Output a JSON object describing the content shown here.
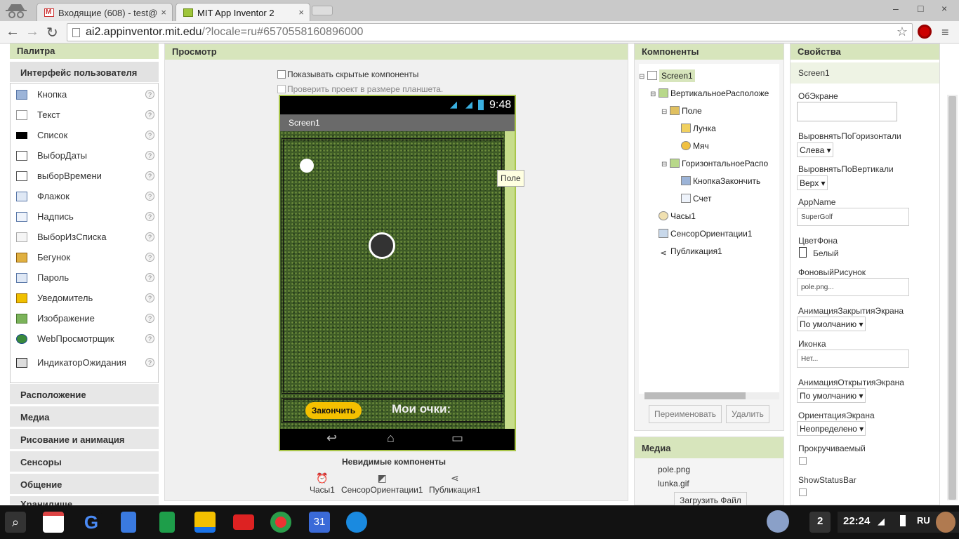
{
  "browser": {
    "tabs": [
      {
        "title": "Входящие (608) - test@",
        "close": "×"
      },
      {
        "title": "MIT App Inventor 2",
        "close": "×"
      }
    ],
    "url_host": "ai2.appinventor.mit.edu",
    "url_path": "/?locale=ru#6570558160896000",
    "window_controls": {
      "minimize": "–",
      "maximize": "□",
      "close": "×"
    }
  },
  "palette": {
    "header": "Палитра",
    "open_category": "Интерфейс пользователя",
    "items": [
      {
        "label": "Кнопка",
        "icon": "button-icon"
      },
      {
        "label": "Текст",
        "icon": "textbox-icon"
      },
      {
        "label": "Список",
        "icon": "listview-icon"
      },
      {
        "label": "ВыборДаты",
        "icon": "datepicker-icon"
      },
      {
        "label": "выборВремени",
        "icon": "timepicker-icon"
      },
      {
        "label": "Флажок",
        "icon": "checkbox-icon"
      },
      {
        "label": "Надпись",
        "icon": "label-icon"
      },
      {
        "label": "ВыборИзСписка",
        "icon": "listpicker-icon"
      },
      {
        "label": "Бегунок",
        "icon": "slider-icon"
      },
      {
        "label": "Пароль",
        "icon": "password-icon"
      },
      {
        "label": "Уведомитель",
        "icon": "notifier-icon"
      },
      {
        "label": "Изображение",
        "icon": "image-icon"
      },
      {
        "label": "WebПросмотрщик",
        "icon": "webviewer-icon"
      },
      {
        "label": "ИндикаторОжидания",
        "icon": "spinner-icon"
      }
    ],
    "help": "?",
    "categories": [
      "Расположение",
      "Медиа",
      "Рисование и анимация",
      "Сенсоры",
      "Общение",
      "Хранилище"
    ]
  },
  "viewer": {
    "header": "Просмотр",
    "show_hidden": "Показывать скрытые компоненты",
    "tablet_size": "Проверить проект в размере планшета.",
    "phone": {
      "time": "9:48",
      "screen_title": "Screen1",
      "finish_button": "Закончить",
      "score_label": "Мои очки:"
    },
    "tooltip": "Поле",
    "invisible_header": "Невидимые компоненты",
    "invisible": [
      {
        "label": "Часы1",
        "icon": "clock-icon"
      },
      {
        "label": "СенсорОриентации1",
        "icon": "orientation-sensor-icon"
      },
      {
        "label": "Публикация1",
        "icon": "share-icon"
      }
    ]
  },
  "components": {
    "header": "Компоненты",
    "tree": [
      {
        "label": "Screen1",
        "toggle": "⊟"
      },
      {
        "label": "ВертикальноеРасположе",
        "toggle": "⊟"
      },
      {
        "label": "Поле",
        "toggle": "⊟"
      },
      {
        "label": "Лунка",
        "toggle": ""
      },
      {
        "label": "Мяч",
        "toggle": ""
      },
      {
        "label": "ГоризонтальноеРаспо",
        "toggle": "⊟"
      },
      {
        "label": "КнопкаЗакончить",
        "toggle": ""
      },
      {
        "label": "Счет",
        "toggle": ""
      },
      {
        "label": "Часы1",
        "toggle": ""
      },
      {
        "label": "СенсорОриентации1",
        "toggle": ""
      },
      {
        "label": "Публикация1",
        "toggle": ""
      }
    ],
    "rename": "Переименовать",
    "delete": "Удалить"
  },
  "media": {
    "header": "Медиа",
    "files": [
      "pole.png",
      "lunka.gif"
    ],
    "upload": "Загрузить Файл"
  },
  "properties": {
    "header": "Свойства",
    "component": "Screen1",
    "about_label": "ОбЭкране",
    "align_h_label": "ВыровнятьПоГоризонтали",
    "align_h_value": "Слева ▾",
    "align_v_label": "ВыровнятьПоВертикали",
    "align_v_value": "Верх ▾",
    "appname_label": "AppName",
    "appname_value": "SuperGolf",
    "bgcolor_label": "ЦветФона",
    "bgcolor_value": "Белый",
    "bgimage_label": "ФоновыйРисунок",
    "bgimage_value": "pole.png...",
    "close_anim_label": "АнимацияЗакрытияЭкрана",
    "close_anim_value": "По умолчанию ▾",
    "icon_label": "Иконка",
    "icon_value": "Нет...",
    "open_anim_label": "АнимацияОткрытияЭкрана",
    "open_anim_value": "По умолчанию ▾",
    "orientation_label": "ОриентацияЭкрана",
    "orientation_value": "Неопределено ▾",
    "scrollable_label": "Прокручиваемый",
    "statusbar_label": "ShowStatusBar"
  },
  "taskbar": {
    "badge": "2",
    "time": "22:24",
    "lang": "RU",
    "calendar_day": "31"
  },
  "colors": {
    "panel_header": "#d7e5bc",
    "accent_green": "#a9c54a",
    "finish_button": "#f4c000"
  }
}
